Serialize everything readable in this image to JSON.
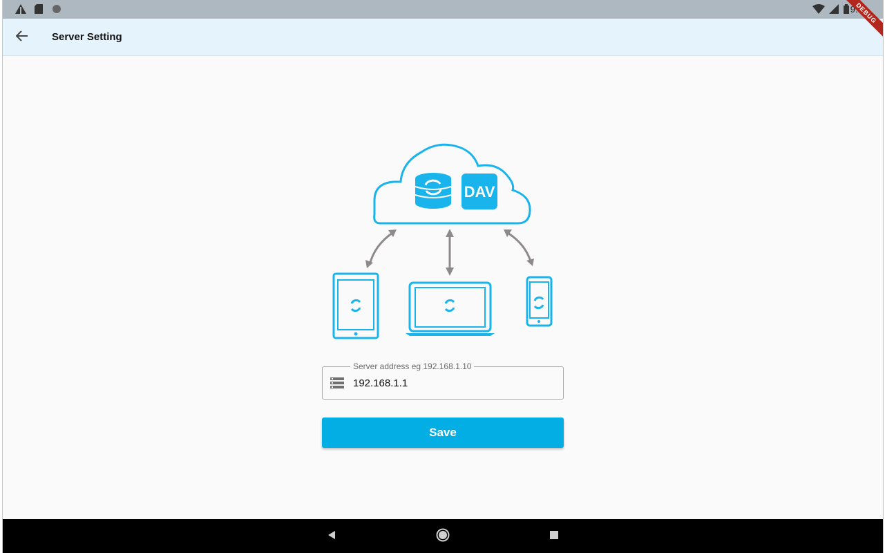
{
  "status_bar": {
    "time": "9:44",
    "icons": [
      "alert-triangle-icon",
      "sd-card-icon",
      "circle-icon",
      "wifi-icon",
      "signal-icon",
      "battery-icon"
    ]
  },
  "app_bar": {
    "title": "Server Setting",
    "back_icon": "arrow-back-icon"
  },
  "debug_banner": "DEBUG",
  "illustration": {
    "cloud_badge_text": "DAV",
    "devices": [
      "tablet-icon",
      "laptop-icon",
      "phone-icon"
    ]
  },
  "server_field": {
    "label": "Server address eg 192.168.1.10",
    "value": "192.168.1.1",
    "icon": "server-stack-icon"
  },
  "save_button": {
    "label": "Save"
  },
  "nav_bar": {
    "buttons": [
      "back-triangle-icon",
      "home-circle-icon",
      "recents-square-icon"
    ]
  },
  "colors": {
    "accent": "#03aee5",
    "app_bar_bg": "#e5f3fd",
    "illustration_blue": "#1ab4ec",
    "arrow_gray": "#8e8a8b"
  }
}
